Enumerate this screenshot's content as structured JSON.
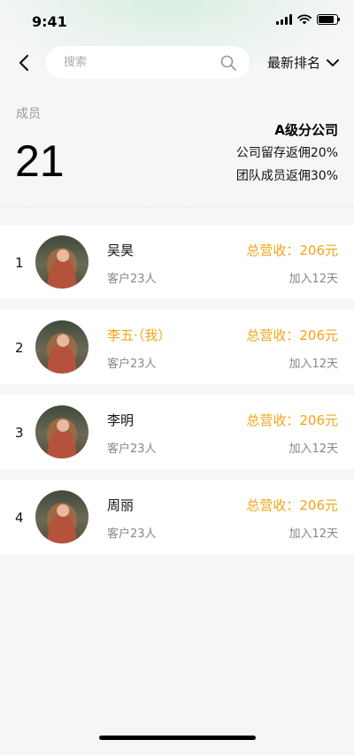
{
  "status_bar": {
    "time": "9:41",
    "battery_level": 0.85
  },
  "nav": {
    "search": {
      "placeholder": "搜索",
      "value": ""
    },
    "sort_label": "最新排名"
  },
  "summary": {
    "member_label": "成员",
    "member_count": "21",
    "company_level": "A级分公司",
    "company_retention": "公司留存返佣20%",
    "team_commission": "团队成员返佣30%"
  },
  "members": [
    {
      "rank": "1",
      "name": "吴昊",
      "is_me": false,
      "customers": "客户23人",
      "revenue": "总营收：206元",
      "joined": "加入12天"
    },
    {
      "rank": "2",
      "name": "李五·（我）",
      "is_me": true,
      "customers": "客户23人",
      "revenue": "总营收：206元",
      "joined": "加入12天"
    },
    {
      "rank": "3",
      "name": "李明",
      "is_me": false,
      "customers": "客户23人",
      "revenue": "总营收：206元",
      "joined": "加入12天"
    },
    {
      "rank": "4",
      "name": "周丽",
      "is_me": false,
      "customers": "客户23人",
      "revenue": "总营收：206元",
      "joined": "加入12天"
    }
  ],
  "colors": {
    "accent": "#f5a418",
    "muted": "#888888",
    "background": "#f6f6f6"
  }
}
